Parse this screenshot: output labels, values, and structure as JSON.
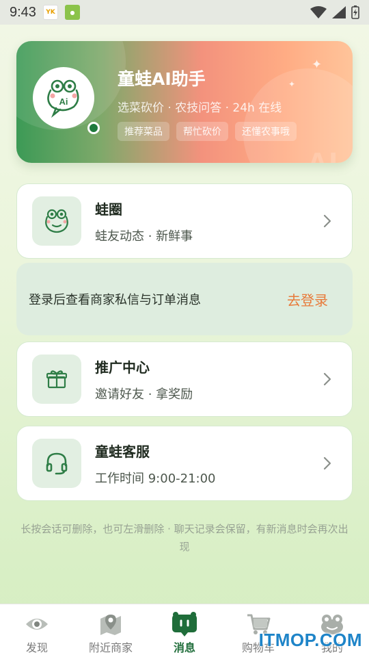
{
  "status_bar": {
    "time": "9:43",
    "app_icons": [
      "yk-app-icon",
      "shop-app-icon"
    ]
  },
  "hero": {
    "title": "童蛙AI助手",
    "subtitle": "选菜砍价 · 农技问答 · 24h 在线",
    "tags": [
      "推荐菜品",
      "帮忙砍价",
      "还懂农事哦"
    ],
    "watermark_text": "AI",
    "avatar_icon": "frog-ai-icon"
  },
  "cards": {
    "frog_circle": {
      "title": "蛙圈",
      "subtitle": "蛙友动态 · 新鲜事",
      "icon": "frog-icon"
    },
    "promo": {
      "title": "推广中心",
      "subtitle": "邀请好友 · 拿奖励",
      "icon": "gift-icon"
    },
    "service": {
      "title": "童蛙客服",
      "subtitle": "工作时间 9:00-21:00",
      "icon": "headset-icon"
    }
  },
  "login_banner": {
    "text": "登录后查看商家私信与订单消息",
    "button": "去登录"
  },
  "hint": "长按会话可删除，也可左滑删除 · 聊天记录会保留，有新消息时会再次出现",
  "bottom_nav": {
    "items": [
      {
        "label": "发现",
        "icon": "eye-icon",
        "active": false
      },
      {
        "label": "附近商家",
        "icon": "map-pin-icon",
        "active": false
      },
      {
        "label": "消息",
        "icon": "chat-icon",
        "active": true
      },
      {
        "label": "购物车",
        "icon": "cart-icon",
        "active": false
      },
      {
        "label": "我的",
        "icon": "frog-profile-icon",
        "active": false
      }
    ]
  },
  "watermark": "ITMOP.COM",
  "colors": {
    "accent_green": "#1f6d3a",
    "login_orange": "#e87a3a",
    "card_icon_bg": "#e2efe2"
  }
}
